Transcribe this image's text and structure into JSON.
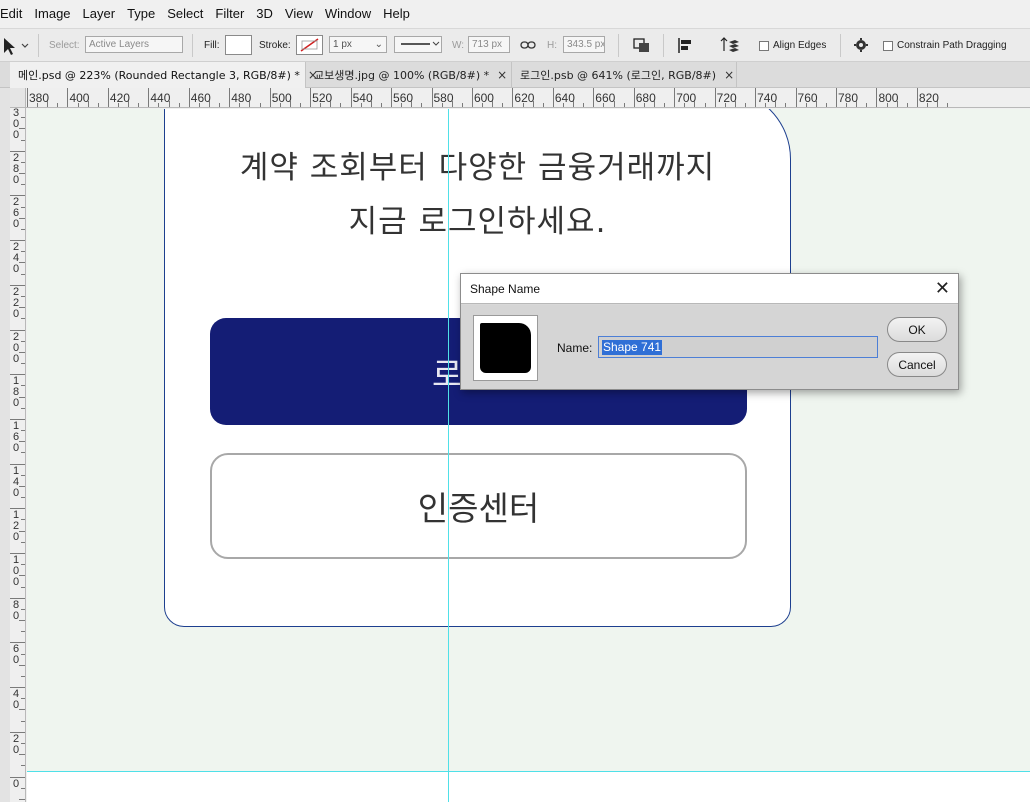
{
  "menu": [
    "Edit",
    "Image",
    "Layer",
    "Type",
    "Select",
    "Filter",
    "3D",
    "View",
    "Window",
    "Help"
  ],
  "options_bar": {
    "select_label": "Select:",
    "select_value": "Active Layers",
    "fill_label": "Fill:",
    "stroke_label": "Stroke:",
    "stroke_width": "1 px",
    "w_label": "W:",
    "w_value": "713 px",
    "h_label": "H:",
    "h_value": "343.5 px",
    "align_edges": "Align Edges",
    "constrain": "Constrain Path Dragging"
  },
  "tabs": [
    {
      "label": "메인.psd @ 223% (Rounded Rectangle 3, RGB/8#) *"
    },
    {
      "label": "교보생명.jpg @ 100% (RGB/8#) *"
    },
    {
      "label": "로그인.psb @ 641% (로그인, RGB/8#)"
    }
  ],
  "tab_close": "×",
  "ruler_h": [
    "380",
    "400",
    "420",
    "440",
    "460",
    "480",
    "500",
    "520",
    "540",
    "560",
    "580",
    "600",
    "620",
    "640",
    "660",
    "680",
    "700",
    "720",
    "740",
    "760",
    "780",
    "800",
    "820"
  ],
  "ruler_v": [
    "300",
    "280",
    "260",
    "240",
    "220",
    "200",
    "180",
    "160",
    "140",
    "120",
    "100",
    "80",
    "60",
    "40",
    "20",
    "0"
  ],
  "canvas": {
    "headline_line1": "계약 조회부터 다양한 금융거래까지",
    "headline_line2": "지금 로그인하세요.",
    "login_button": "로그인",
    "login_button_visible": "로",
    "cert_button": "인증센터"
  },
  "dialog": {
    "title": "Shape Name",
    "close": "✕",
    "name_label": "Name:",
    "name_value": "Shape 741",
    "ok": "OK",
    "cancel": "Cancel"
  },
  "colors": {
    "login_button": "#141d75",
    "card_border": "#1d3f8f",
    "guide": "#4fe0e8",
    "canvas_bg": "#eff5ef"
  }
}
